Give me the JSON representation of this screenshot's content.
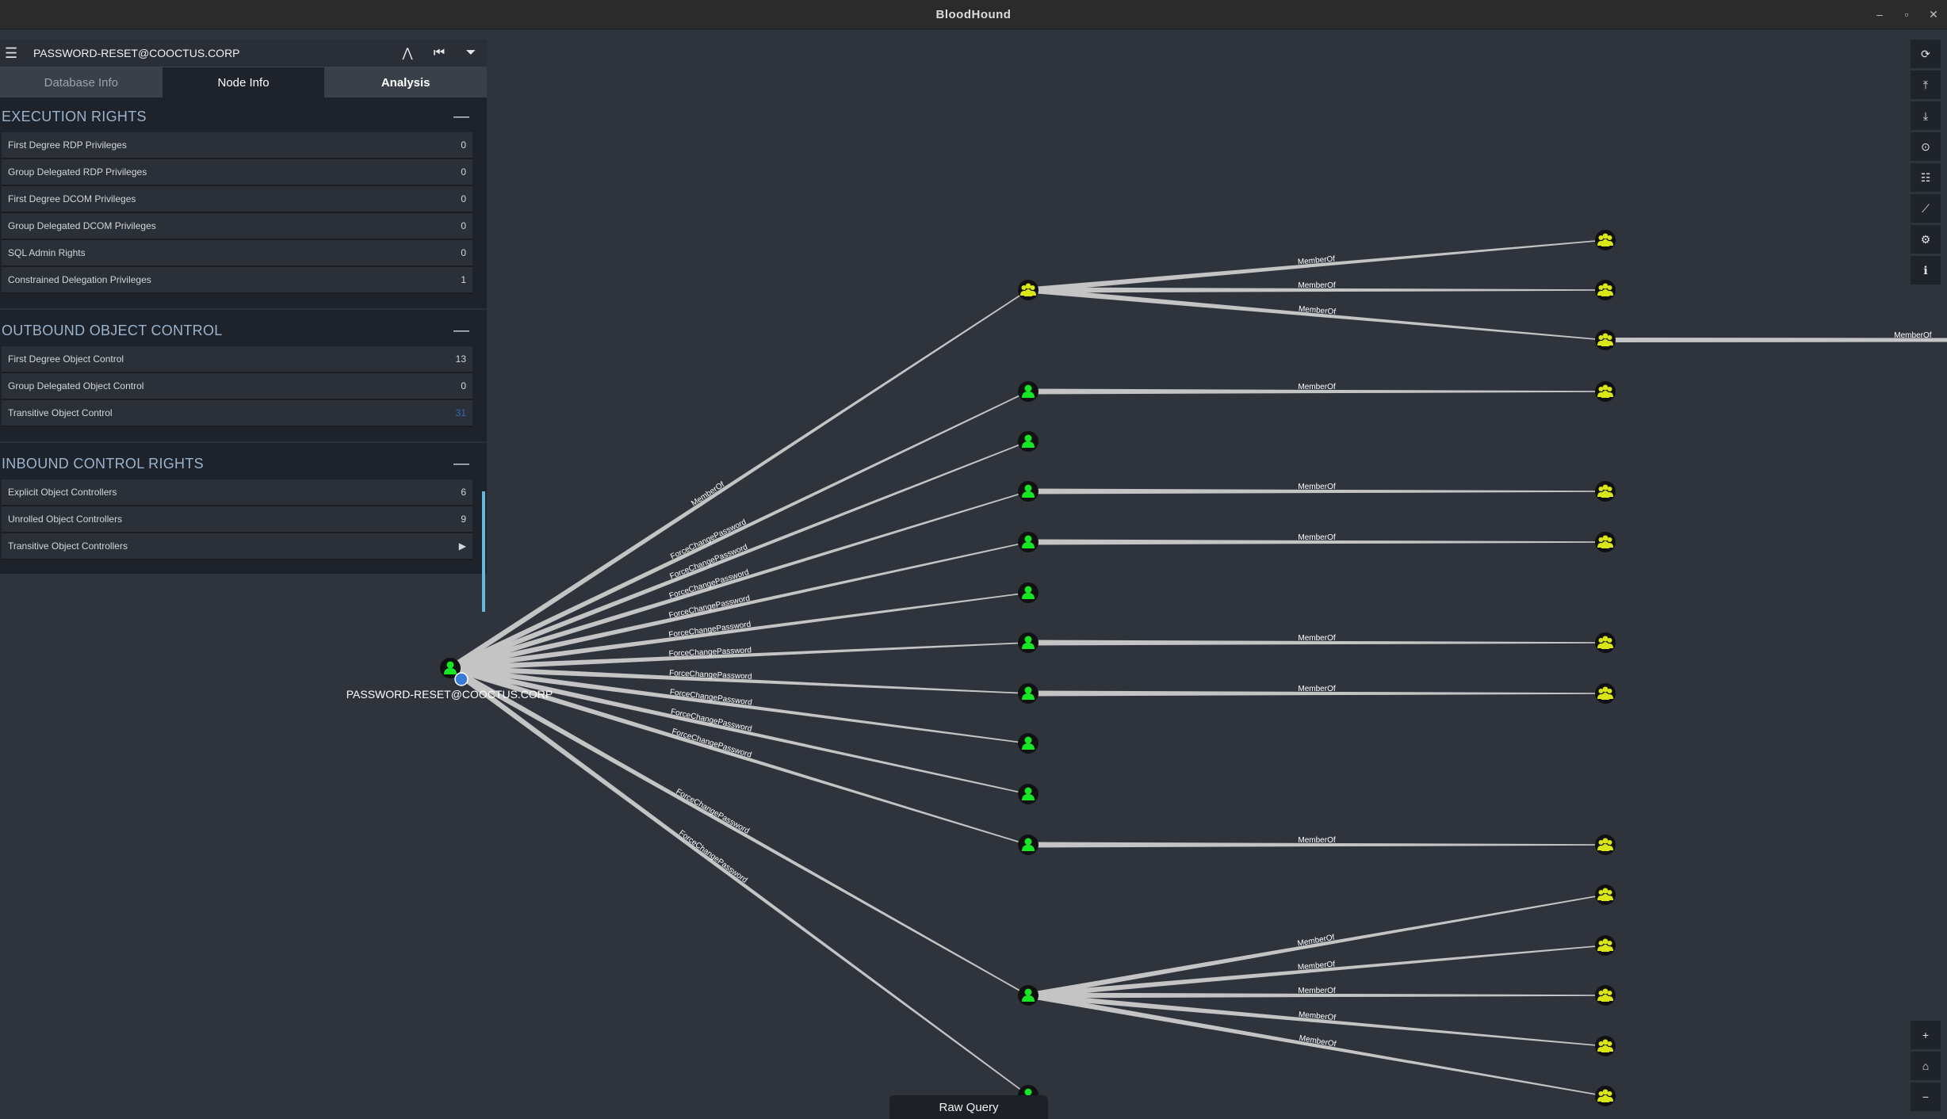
{
  "window": {
    "title": "BloodHound"
  },
  "search": {
    "node_name": "PASSWORD-RESET@COOCTUS.CORP"
  },
  "tabs": {
    "database_info": "Database Info",
    "node_info": "Node Info",
    "analysis": "Analysis"
  },
  "sections": {
    "execution": {
      "title": "EXECUTION RIGHTS",
      "rows": [
        {
          "label": "First Degree RDP Privileges",
          "value": "0"
        },
        {
          "label": "Group Delegated RDP Privileges",
          "value": "0"
        },
        {
          "label": "First Degree DCOM Privileges",
          "value": "0"
        },
        {
          "label": "Group Delegated DCOM Privileges",
          "value": "0"
        },
        {
          "label": "SQL Admin Rights",
          "value": "0"
        },
        {
          "label": "Constrained Delegation Privileges",
          "value": "1"
        }
      ]
    },
    "outbound": {
      "title": "OUTBOUND OBJECT CONTROL",
      "rows": [
        {
          "label": "First Degree Object Control",
          "value": "13"
        },
        {
          "label": "Group Delegated Object Control",
          "value": "0"
        },
        {
          "label": "Transitive Object Control",
          "value": "31"
        }
      ]
    },
    "inbound": {
      "title": "INBOUND CONTROL RIGHTS",
      "rows": [
        {
          "label": "Explicit Object Controllers",
          "value": "6"
        },
        {
          "label": "Unrolled Object Controllers",
          "value": "9"
        },
        {
          "label": "Transitive Object Controllers",
          "value": "▶"
        }
      ]
    }
  },
  "graph": {
    "center_label": "PASSWORD-RESET@COOCTUS.CORP",
    "edge_labels": {
      "member_of": "MemberOf",
      "force_change_password": "ForceChangePassword"
    },
    "colors": {
      "user": "#17e625",
      "group": "#dbe617",
      "node_bg": "#111111",
      "edge": "#c4c4c4"
    }
  },
  "toolbar": {
    "icons": [
      "refresh-icon",
      "upload-icon",
      "download-icon",
      "upload-circle-icon",
      "query-list-icon",
      "chart-icon",
      "settings-icon",
      "info-icon"
    ],
    "zoom_icons": [
      "zoom-in-icon",
      "home-icon",
      "zoom-out-icon"
    ]
  },
  "raw_query": {
    "label": "Raw Query"
  }
}
